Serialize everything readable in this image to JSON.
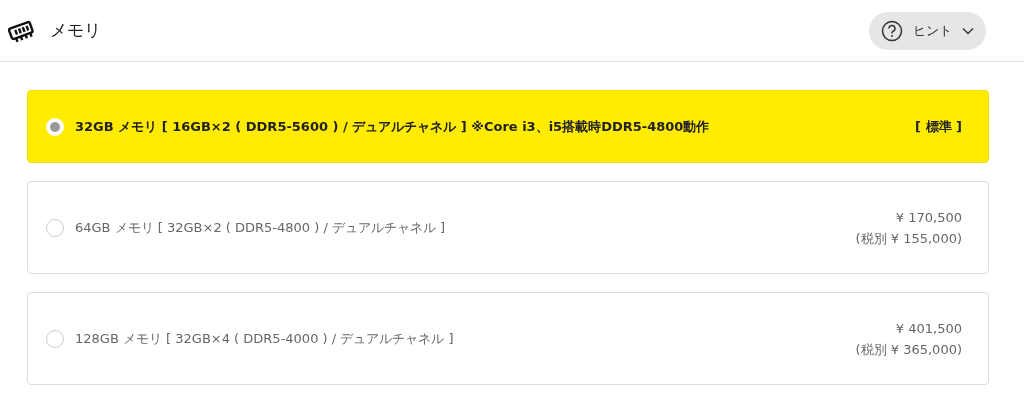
{
  "header": {
    "title": "メモリ",
    "hint_button": {
      "label": "ヒント",
      "expanded": false
    }
  },
  "options": [
    {
      "label": "32GB メモリ [ 16GB×2 ( DDR5-5600 ) / デュアルチャネル ] ※Core i3、i5搭載時DDR5-4800動作",
      "selected": true,
      "badge": "[ 標準 ]"
    },
    {
      "label": "64GB メモリ [ 32GB×2 ( DDR5-4800 ) / デュアルチャネル ]",
      "selected": false,
      "price": "¥ 170,500",
      "price_ex_tax": "(税別 ¥ 155,000)"
    },
    {
      "label": "128GB メモリ [ 32GB×4 ( DDR5-4000 ) / デュアルチャネル ]",
      "selected": false,
      "price": "¥ 401,500",
      "price_ex_tax": "(税別 ¥ 365,000)"
    }
  ]
}
